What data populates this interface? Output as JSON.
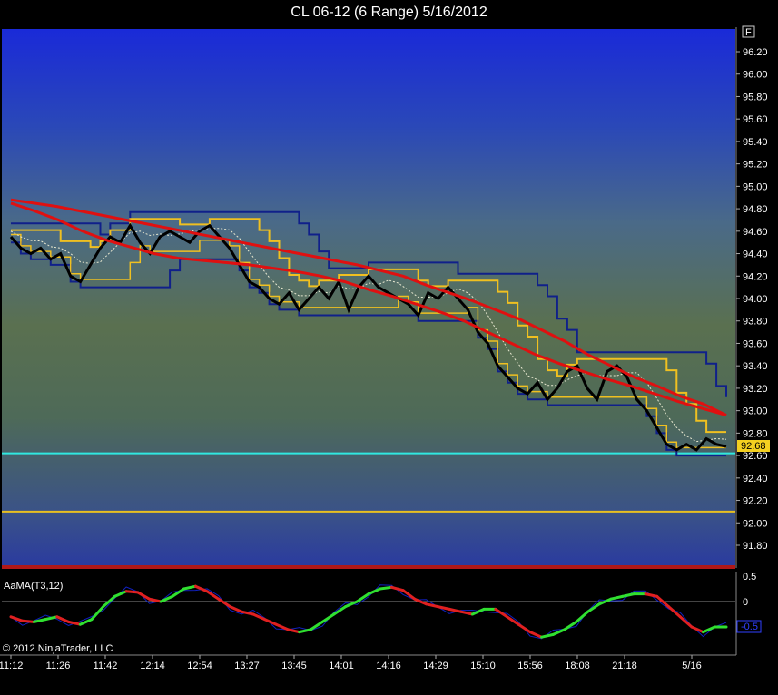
{
  "title": "CL 06-12 (6 Range)  5/16/2012",
  "copyright": "© 2012 NinjaTrader, LLC",
  "panel_button": "F",
  "colors": {
    "price": "#000000",
    "ma_slow": "#e01010",
    "channel_outer": "#10208a",
    "channel_inner": "#f0c020",
    "dashed": "#e8e8d0",
    "hline_cyan": "#30e8e0",
    "hline_yellow": "#e8c020",
    "osc_up": "#30e030",
    "osc_down": "#e02020",
    "osc_raw": "#1020c0"
  },
  "chart_data": [
    {
      "type": "line",
      "name": "price-panel",
      "ylim": [
        91.6,
        96.4
      ],
      "yticks": [
        "96.20",
        "96.00",
        "95.80",
        "95.60",
        "95.40",
        "95.20",
        "95.00",
        "94.80",
        "94.60",
        "94.40",
        "94.20",
        "94.00",
        "93.80",
        "93.60",
        "93.40",
        "93.20",
        "93.00",
        "92.80",
        "92.60",
        "92.40",
        "92.20",
        "92.00",
        "91.80"
      ],
      "last_price_label": "92.68",
      "last_price": 92.68,
      "horizontal_lines": [
        92.62,
        92.1
      ],
      "x_labels": [
        "11:12",
        "11:26",
        "11:42",
        "12:14",
        "12:54",
        "13:27",
        "13:45",
        "14:01",
        "14:16",
        "14:29",
        "15:10",
        "15:56",
        "18:08",
        "21:18",
        "5/16"
      ],
      "price_series": [
        94.55,
        94.45,
        94.4,
        94.45,
        94.35,
        94.4,
        94.2,
        94.15,
        94.3,
        94.45,
        94.55,
        94.5,
        94.65,
        94.5,
        94.4,
        94.55,
        94.6,
        94.55,
        94.5,
        94.6,
        94.65,
        94.55,
        94.45,
        94.3,
        94.15,
        94.1,
        94.0,
        93.95,
        94.05,
        93.9,
        94.0,
        94.1,
        94.0,
        94.15,
        93.9,
        94.1,
        94.2,
        94.1,
        94.05,
        94.0,
        93.95,
        93.85,
        94.05,
        94.0,
        94.1,
        94.0,
        93.9,
        93.7,
        93.6,
        93.4,
        93.3,
        93.2,
        93.15,
        93.25,
        93.1,
        93.2,
        93.35,
        93.4,
        93.2,
        93.1,
        93.35,
        93.4,
        93.3,
        93.1,
        93.0,
        92.85,
        92.7,
        92.65,
        92.7,
        92.65,
        92.75,
        92.7,
        92.68
      ],
      "series": [
        {
          "name": "",
          "values": [
            94.88,
            94.85,
            94.82,
            94.78,
            94.74,
            94.7,
            94.66,
            94.62,
            94.58,
            94.54,
            94.5,
            94.46,
            94.42,
            94.38,
            94.34,
            94.3,
            94.25,
            94.2,
            94.12,
            94.05,
            93.98,
            93.9,
            93.82,
            93.72,
            93.62,
            93.5,
            93.4,
            93.3,
            93.22,
            93.13,
            93.06,
            92.96
          ]
        },
        {
          "name": "",
          "values": [
            94.85,
            94.78,
            94.7,
            94.6,
            94.52,
            94.46,
            94.4,
            94.36,
            94.34,
            94.32,
            94.3,
            94.27,
            94.24,
            94.2,
            94.15,
            94.08,
            94.02,
            93.95,
            93.88,
            93.8,
            93.7,
            93.6,
            93.5,
            93.42,
            93.35,
            93.28,
            93.22,
            93.15,
            93.08,
            93.02,
            92.96
          ]
        }
      ]
    },
    {
      "type": "line",
      "name": "oscillator-panel",
      "label": "AaMA(T3,12)",
      "ylim": [
        -0.7,
        0.6
      ],
      "yticks": [
        "0.5",
        "0"
      ],
      "last_value_label": "-0.5",
      "last_value": -0.5,
      "values": [
        -0.3,
        -0.38,
        -0.4,
        -0.35,
        -0.3,
        -0.4,
        -0.45,
        -0.35,
        -0.1,
        0.1,
        0.2,
        0.18,
        0.05,
        0.0,
        0.1,
        0.25,
        0.3,
        0.2,
        0.05,
        -0.1,
        -0.2,
        -0.25,
        -0.35,
        -0.45,
        -0.55,
        -0.6,
        -0.55,
        -0.4,
        -0.25,
        -0.1,
        0.0,
        0.15,
        0.25,
        0.28,
        0.22,
        0.05,
        -0.05,
        -0.1,
        -0.15,
        -0.2,
        -0.25,
        -0.15,
        -0.15,
        -0.3,
        -0.45,
        -0.6,
        -0.7,
        -0.65,
        -0.55,
        -0.4,
        -0.2,
        -0.05,
        0.05,
        0.1,
        0.15,
        0.15,
        0.1,
        -0.1,
        -0.3,
        -0.5,
        -0.6,
        -0.5,
        -0.5
      ]
    }
  ]
}
